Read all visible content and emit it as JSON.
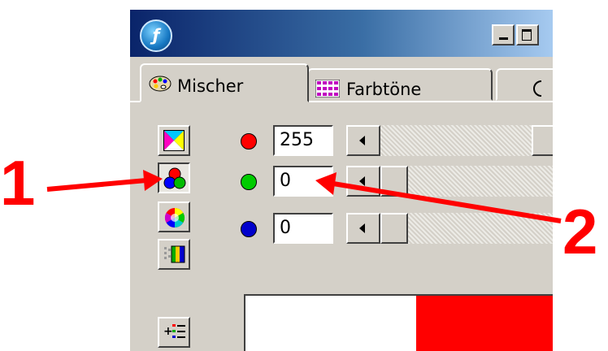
{
  "window": {
    "logo_glyph": "ƒ"
  },
  "tabs": [
    {
      "label": "Mischer",
      "icon": "palette-icon",
      "active": true
    },
    {
      "label": "Farbtöne",
      "icon": "grid-icon",
      "active": false
    },
    {
      "label": "",
      "icon": "partial-icon",
      "active": false
    }
  ],
  "mode_buttons": [
    {
      "name": "cmyk-mode",
      "icon": "cmy-triangles-icon",
      "pressed": false
    },
    {
      "name": "rgb-mode",
      "icon": "rgb-circles-icon",
      "pressed": true
    },
    {
      "name": "hsb-mode",
      "icon": "color-wheel-icon",
      "pressed": false
    },
    {
      "name": "palette-mode",
      "icon": "swatch-grid-icon",
      "pressed": false
    }
  ],
  "channels": [
    {
      "name": "red",
      "color": "#ff0000",
      "value": "255",
      "slider_fraction": 1.0
    },
    {
      "name": "green",
      "color": "#00cc00",
      "value": "0",
      "slider_fraction": 0.0
    },
    {
      "name": "blue",
      "color": "#0000cc",
      "value": "0",
      "slider_fraction": 0.0
    }
  ],
  "preview": {
    "new_color": "#ff0000"
  },
  "annotations": [
    {
      "label": "1",
      "color": "#ff0000"
    },
    {
      "label": "2",
      "color": "#ff0000"
    }
  ]
}
